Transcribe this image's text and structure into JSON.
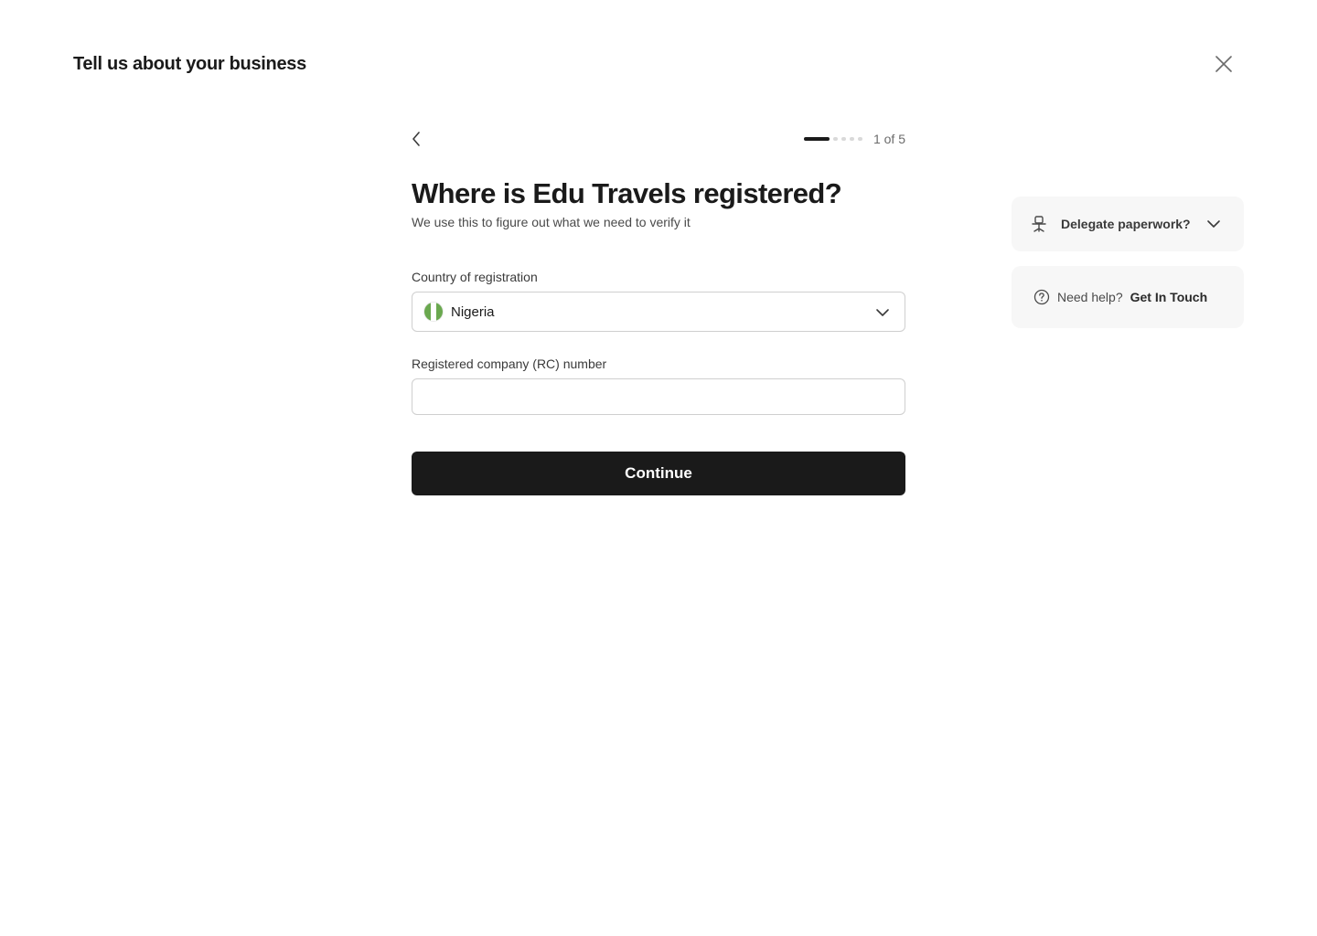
{
  "header": {
    "title": "Tell us about your business",
    "close_icon": "close-icon"
  },
  "stepper": {
    "back_icon": "chevron-left-icon",
    "current_step": 1,
    "total_steps": 5,
    "progress_text": "1 of 5"
  },
  "form": {
    "heading": "Where is Edu Travels registered?",
    "subheading": "We use this to figure out what we need to verify it",
    "country_label": "Country of registration",
    "country_value": "Nigeria",
    "country_flag_icon": "nigeria-flag-icon",
    "rc_label": "Registered company (RC) number",
    "rc_value": "",
    "rc_placeholder": "",
    "continue_label": "Continue"
  },
  "sidebar": {
    "delegate_label": "Delegate paperwork?",
    "delegate_icon": "office-chair-icon",
    "help_text": "Need help?",
    "help_icon": "question-circle-icon",
    "help_link": "Get In Touch"
  },
  "colors": {
    "primary_button": "#1a1a1a",
    "card_background": "#f7f7f7",
    "flag_green": "#6aa84f",
    "progress_active": "#1a1a1a",
    "progress_inactive": "#d9d9d9"
  }
}
